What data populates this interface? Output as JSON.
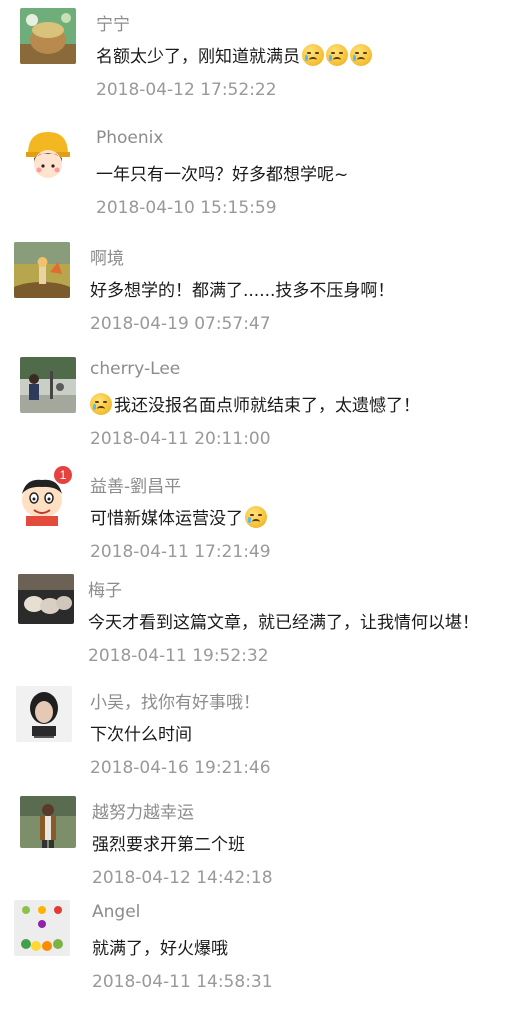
{
  "comments": [
    {
      "name": "宁宁",
      "text": "名额太少了，刚知道就满员",
      "trailing_emojis": 3,
      "time": "2018-04-12 17:52:22",
      "avatar_icon": "photo-avatar-icon"
    },
    {
      "name": "Phoenix",
      "text": "一年只有一次吗？好多都想学呢~",
      "time": "2018-04-10 15:15:59",
      "avatar_icon": "cartoon-girl-avatar-icon"
    },
    {
      "name": "啊境",
      "text": "好多想学的！都满了......技多不压身啊！",
      "time": "2018-04-19 07:57:47",
      "avatar_icon": "little-prince-avatar-icon"
    },
    {
      "name": "cherry-Lee",
      "text": "我还没报名面点师就结束了，太遗憾了！",
      "leading_emoji": true,
      "time": "2018-04-11 20:11:00",
      "avatar_icon": "street-photo-avatar-icon"
    },
    {
      "name": "益善-劉昌平",
      "text": "可惜新媒体运营没了",
      "trailing_emojis": 1,
      "time": "2018-04-11 17:21:49",
      "avatar_icon": "cartoon-boy-avatar-icon",
      "badge": "1"
    },
    {
      "name": "梅子",
      "text": "今天才看到这篇文章，就已经满了，让我情何以堪！",
      "time": "2018-04-11 19:52:32",
      "avatar_icon": "sheep-photo-avatar-icon"
    },
    {
      "name": "小吴，找你有好事哦！",
      "text": "下次什么时间",
      "time": "2018-04-16 19:21:46",
      "avatar_icon": "portrait-avatar-icon"
    },
    {
      "name": "越努力越幸运",
      "text": "强烈要求开第二个班",
      "time": "2018-04-12 14:42:18",
      "avatar_icon": "person-photo-avatar-icon"
    },
    {
      "name": "Angel",
      "text": "就满了，好火爆哦",
      "time": "2018-04-11 14:58:31",
      "avatar_icon": "candy-avatar-icon"
    }
  ]
}
